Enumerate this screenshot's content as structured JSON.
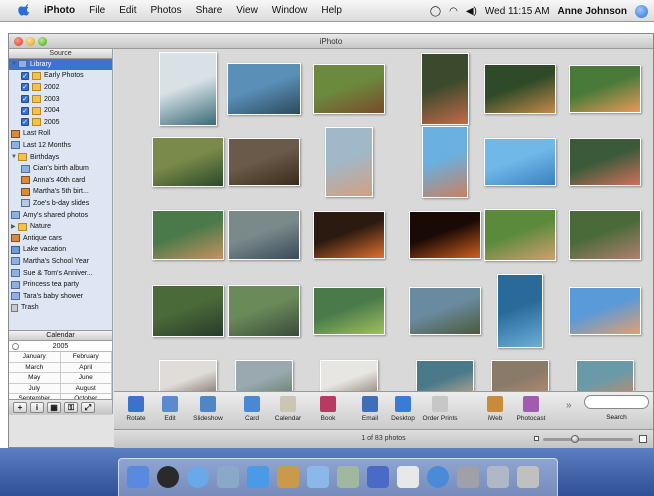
{
  "menubar": {
    "app_name": "iPhoto",
    "menus": [
      "File",
      "Edit",
      "Photos",
      "Share",
      "View",
      "Window",
      "Help"
    ],
    "clock": "Wed 11:15 AM",
    "user": "Anne Johnson"
  },
  "window": {
    "title": "iPhoto"
  },
  "sidebar": {
    "source_header": "Source",
    "items": [
      {
        "label": "Library",
        "icon": "library-icon",
        "selected": true,
        "disclosure": "▼"
      },
      {
        "label": "Early Photos",
        "icon": "folder-icon",
        "checked": true
      },
      {
        "label": "2002",
        "icon": "folder-icon",
        "checked": true
      },
      {
        "label": "2003",
        "icon": "folder-icon",
        "checked": true
      },
      {
        "label": "2004",
        "icon": "folder-icon",
        "checked": true
      },
      {
        "label": "2005",
        "icon": "folder-icon",
        "checked": true
      },
      {
        "label": "Last Roll",
        "icon": "roll-icon"
      },
      {
        "label": "Last 12 Months",
        "icon": "calendar-icon"
      },
      {
        "label": "Birthdays",
        "icon": "folder-icon",
        "disclosure": "▼"
      },
      {
        "label": "Cian's birth album",
        "icon": "album-icon"
      },
      {
        "label": "Anna's 40th card",
        "icon": "card-icon"
      },
      {
        "label": "Martha's 5th birt...",
        "icon": "book-icon"
      },
      {
        "label": "Zoe's b-day slides",
        "icon": "slideshow-icon"
      },
      {
        "label": "Amy's shared photos",
        "icon": "shared-album-icon"
      },
      {
        "label": "Nature",
        "icon": "folder-icon",
        "disclosure": "▶"
      },
      {
        "label": "Antique cars",
        "icon": "book-icon"
      },
      {
        "label": "Lake vacation",
        "icon": "smart-album-icon"
      },
      {
        "label": "Martha's School Year",
        "icon": "album-icon"
      },
      {
        "label": "Sue & Tom's Anniver...",
        "icon": "album-icon"
      },
      {
        "label": "Princess tea party",
        "icon": "album-icon"
      },
      {
        "label": "Tara's baby shower",
        "icon": "album-icon"
      },
      {
        "label": "Trash",
        "icon": "trash-icon"
      }
    ]
  },
  "calendar": {
    "header": "Calendar",
    "year": "2005",
    "months": [
      "January",
      "February",
      "March",
      "April",
      "May",
      "June",
      "July",
      "August",
      "September",
      "October",
      "November",
      "December"
    ]
  },
  "toolbar": {
    "tools": [
      {
        "label": "Rotate",
        "icon": "rotate-icon",
        "color": "#3a73c9"
      },
      {
        "label": "Edit",
        "icon": "edit-icon",
        "color": "#5a8ad0"
      },
      {
        "label": "Slideshow",
        "icon": "slideshow-icon",
        "color": "#4f87c4"
      },
      {
        "label": "Card",
        "icon": "card-icon",
        "color": "#4a88d6"
      },
      {
        "label": "Calendar",
        "icon": "calendar-icon",
        "color": "#c9c7b4"
      },
      {
        "label": "Book",
        "icon": "book-icon",
        "color": "#b83a63"
      },
      {
        "label": "Email",
        "icon": "email-icon",
        "color": "#3f6fb8"
      },
      {
        "label": "Desktop",
        "icon": "desktop-icon",
        "color": "#3a7bd5"
      },
      {
        "label": "Order Prints",
        "icon": "order-prints-icon",
        "color": "#c7c7c7"
      },
      {
        "label": "iWeb",
        "icon": "iweb-icon",
        "color": "#c98a3a"
      },
      {
        "label": "Photocast",
        "icon": "photocast-icon",
        "color": "#a15bb0"
      }
    ],
    "more": "»",
    "search_label": "Search"
  },
  "status": {
    "photo_count": "1 of 83 photos"
  },
  "photos": [
    {
      "c1": "#d8e2e6",
      "c2": "#3a6b7a"
    },
    {
      "c1": "#5a8fb8",
      "c2": "#2c4a5c"
    },
    {
      "c1": "#6b8a3e",
      "c2": "#7a4a2a"
    },
    {
      "c1": "#3b4a2c",
      "c2": "#c46a4a"
    },
    {
      "c1": "#2f4a28",
      "c2": "#c48a4a"
    },
    {
      "c1": "#4a7a3a",
      "c2": "#e89a5a"
    },
    {
      "c1": "#7a8a4a",
      "c2": "#2a4a2a"
    },
    {
      "c1": "#6a5a4a",
      "c2": "#3a2a1a"
    },
    {
      "c1": "#a0b8c8",
      "c2": "#d4a080"
    },
    {
      "c1": "#6ab0e0",
      "c2": "#c88060"
    },
    {
      "c1": "#70b8e8",
      "c2": "#3a80c0"
    },
    {
      "c1": "#3a5a3a",
      "c2": "#d0705a"
    },
    {
      "c1": "#4a7a4a",
      "c2": "#c89060"
    },
    {
      "c1": "#7a8a8a",
      "c2": "#3a4a5a"
    },
    {
      "c1": "#2a1a10",
      "c2": "#e07030"
    },
    {
      "c1": "#1a0a05",
      "c2": "#d06020"
    },
    {
      "c1": "#5a8a3a",
      "c2": "#d0a070"
    },
    {
      "c1": "#4a6a3a",
      "c2": "#b08070"
    },
    {
      "c1": "#4a6a3a",
      "c2": "#2a3a2a"
    },
    {
      "c1": "#6a8a5a",
      "c2": "#3a4a3a"
    },
    {
      "c1": "#4a7a4a",
      "c2": "#a0c060"
    },
    {
      "c1": "#6a8aa0",
      "c2": "#4a5a3a"
    },
    {
      "c1": "#2a6a9a",
      "c2": "#6ab0d8"
    },
    {
      "c1": "#5a9ad8",
      "c2": "#e0a070"
    },
    {
      "c1": "#e0dcd8",
      "c2": "#6a5a4a"
    },
    {
      "c1": "#9aa8b0",
      "c2": "#5a7a5a"
    },
    {
      "c1": "#e8e6e2",
      "c2": "#7a6a5a"
    },
    {
      "c1": "#4a7a8a",
      "c2": "#d0b090"
    },
    {
      "c1": "#8a7a6a",
      "c2": "#c09070"
    },
    {
      "c1": "#6a9aa8",
      "c2": "#d08a60"
    }
  ],
  "dock": [
    {
      "icon": "finder-icon",
      "color": "#5a8ae0"
    },
    {
      "icon": "dashboard-icon",
      "color": "#2a2a2a"
    },
    {
      "icon": "safari-icon",
      "color": "#6aa8e8"
    },
    {
      "icon": "mail-icon",
      "color": "#8aa8c8"
    },
    {
      "icon": "ichat-icon",
      "color": "#4a9ae8"
    },
    {
      "icon": "address-book-icon",
      "color": "#c89a4a"
    },
    {
      "icon": "itunes-icon",
      "color": "#8ab8e8"
    },
    {
      "icon": "iphoto-icon",
      "color": "#a0b8a0"
    },
    {
      "icon": "imovie-icon",
      "color": "#4a6ac8"
    },
    {
      "icon": "ical-icon",
      "color": "#e8e8e8"
    },
    {
      "icon": "quicktime-icon",
      "color": "#4a8ad8"
    },
    {
      "icon": "system-preferences-icon",
      "color": "#a0a0a8"
    },
    {
      "icon": "downloads-icon",
      "color": "#b0b8c8"
    },
    {
      "icon": "trash-icon",
      "color": "#c0c0c0"
    }
  ]
}
